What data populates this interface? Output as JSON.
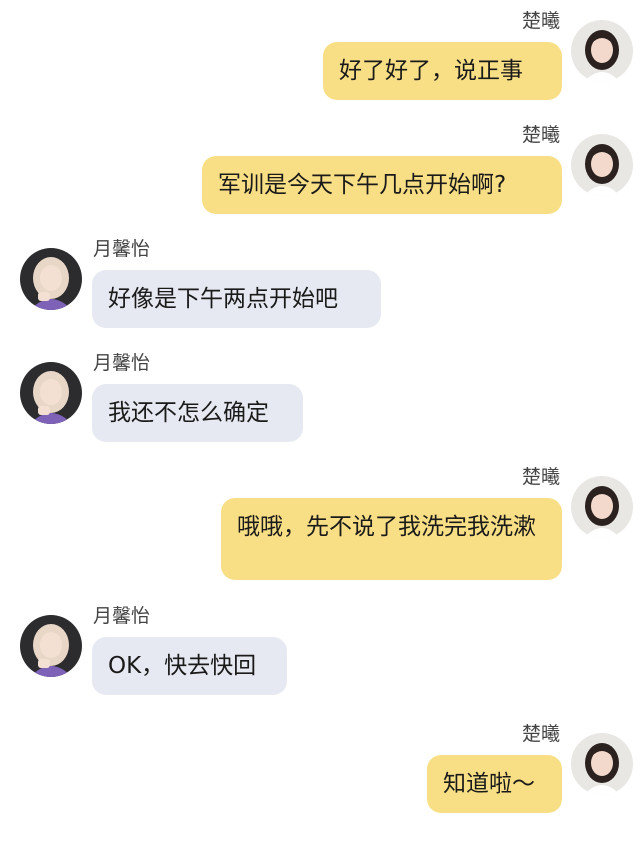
{
  "colors": {
    "outgoing_bubble": "#f8df85",
    "incoming_bubble": "#e6e9f1",
    "name_text": "#444444",
    "message_text": "#1a1a1a"
  },
  "users": {
    "self": {
      "name": "楚曦",
      "avatar_icon": "avatar-self-photo"
    },
    "other": {
      "name": "月馨怡",
      "avatar_icon": "avatar-other-photo"
    }
  },
  "messages": [
    {
      "sender": "楚曦",
      "side": "right",
      "text": "好了好了，说正事"
    },
    {
      "sender": "楚曦",
      "side": "right",
      "text": "军训是今天下午几点开始啊?"
    },
    {
      "sender": "月馨怡",
      "side": "left",
      "text": "好像是下午两点开始吧"
    },
    {
      "sender": "月馨怡",
      "side": "left",
      "text": "我还不怎么确定"
    },
    {
      "sender": "楚曦",
      "side": "right",
      "text": "哦哦，先不说了我洗完我洗漱"
    },
    {
      "sender": "月馨怡",
      "side": "left",
      "text": "OK，快去快回"
    },
    {
      "sender": "楚曦",
      "side": "right",
      "text": "知道啦～"
    }
  ]
}
